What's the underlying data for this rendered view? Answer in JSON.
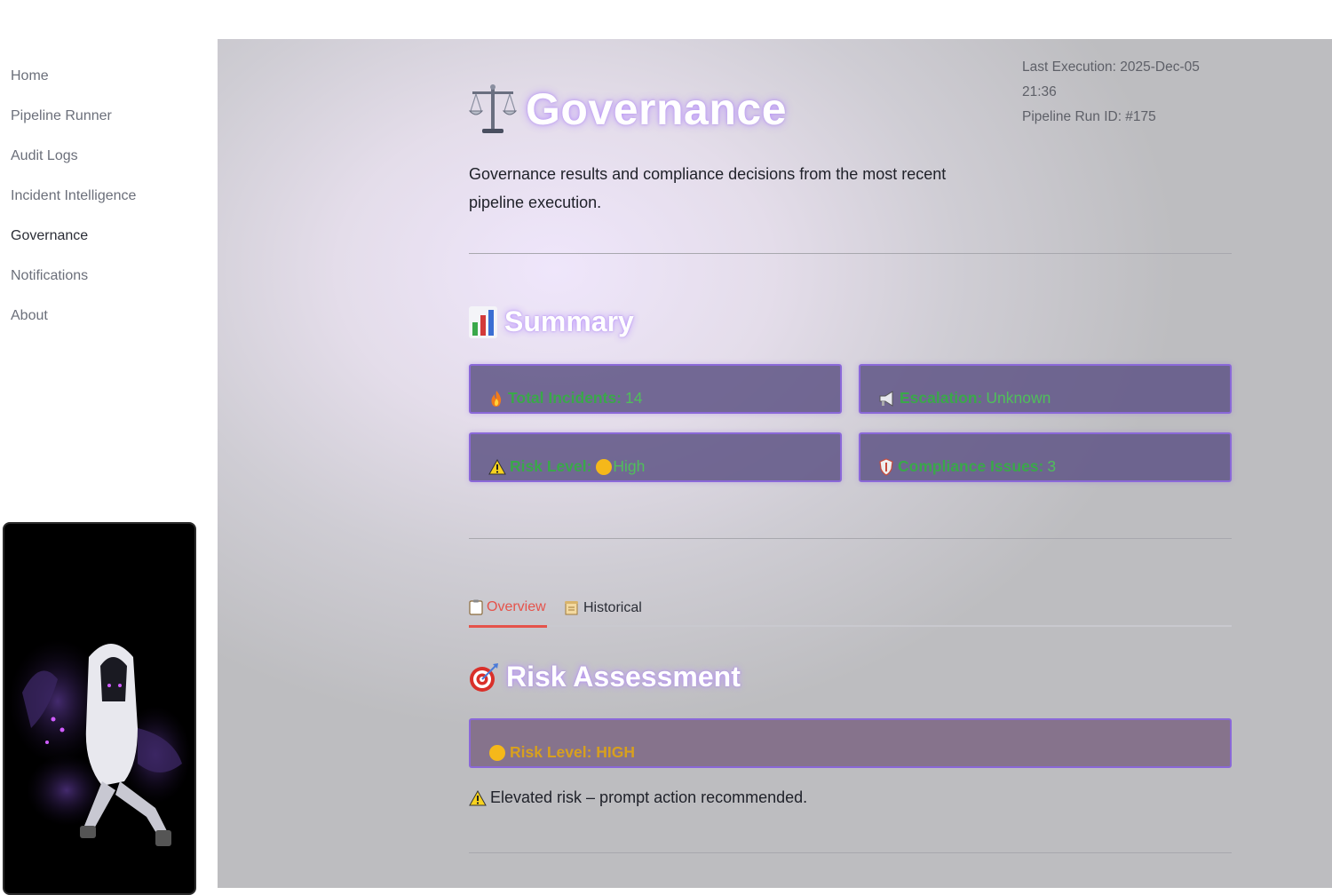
{
  "sidebar": {
    "items": [
      {
        "label": "Home"
      },
      {
        "label": "Pipeline Runner"
      },
      {
        "label": "Audit Logs"
      },
      {
        "label": "Incident Intelligence"
      },
      {
        "label": "Governance",
        "active": true
      },
      {
        "label": "Notifications"
      },
      {
        "label": "About"
      }
    ]
  },
  "header": {
    "title": "Governance",
    "title_icon": "balance-scale-icon",
    "subtitle": "Governance results and compliance decisions from the most recent pipeline execution."
  },
  "meta": {
    "last_execution": "Last Execution: 2025-Dec-05 21:36",
    "run_id": "Pipeline Run ID: #175"
  },
  "summary": {
    "title": "Summary",
    "icon": "bar-chart-icon",
    "metrics": {
      "total_incidents": {
        "label": "Total Incidents:",
        "value": "14",
        "icon": "fire-icon"
      },
      "escalation": {
        "label": "Escalation:",
        "value": "Unknown",
        "icon": "megaphone-icon"
      },
      "risk_level": {
        "label": "Risk Level:",
        "value": "High",
        "icon": "warning-icon",
        "indicator_icon": "yellow-circle-icon"
      },
      "compliance_issues": {
        "label": "Compliance Issues:",
        "value": "3",
        "icon": "shield-icon"
      }
    }
  },
  "tabs": [
    {
      "label": "Overview",
      "icon": "clipboard-icon",
      "active": true
    },
    {
      "label": "Historical",
      "icon": "scroll-icon",
      "active": false
    }
  ],
  "risk_assessment": {
    "title": "Risk Assessment",
    "icon": "target-icon",
    "level_text": "Risk Level: HIGH",
    "advice": "Elevated risk – prompt action recommended."
  },
  "colors": {
    "accent_red": "#e5534b",
    "metric_green": "#3aa84a",
    "risk_amber": "#d8a01e",
    "card_border": "#8a68d8"
  }
}
